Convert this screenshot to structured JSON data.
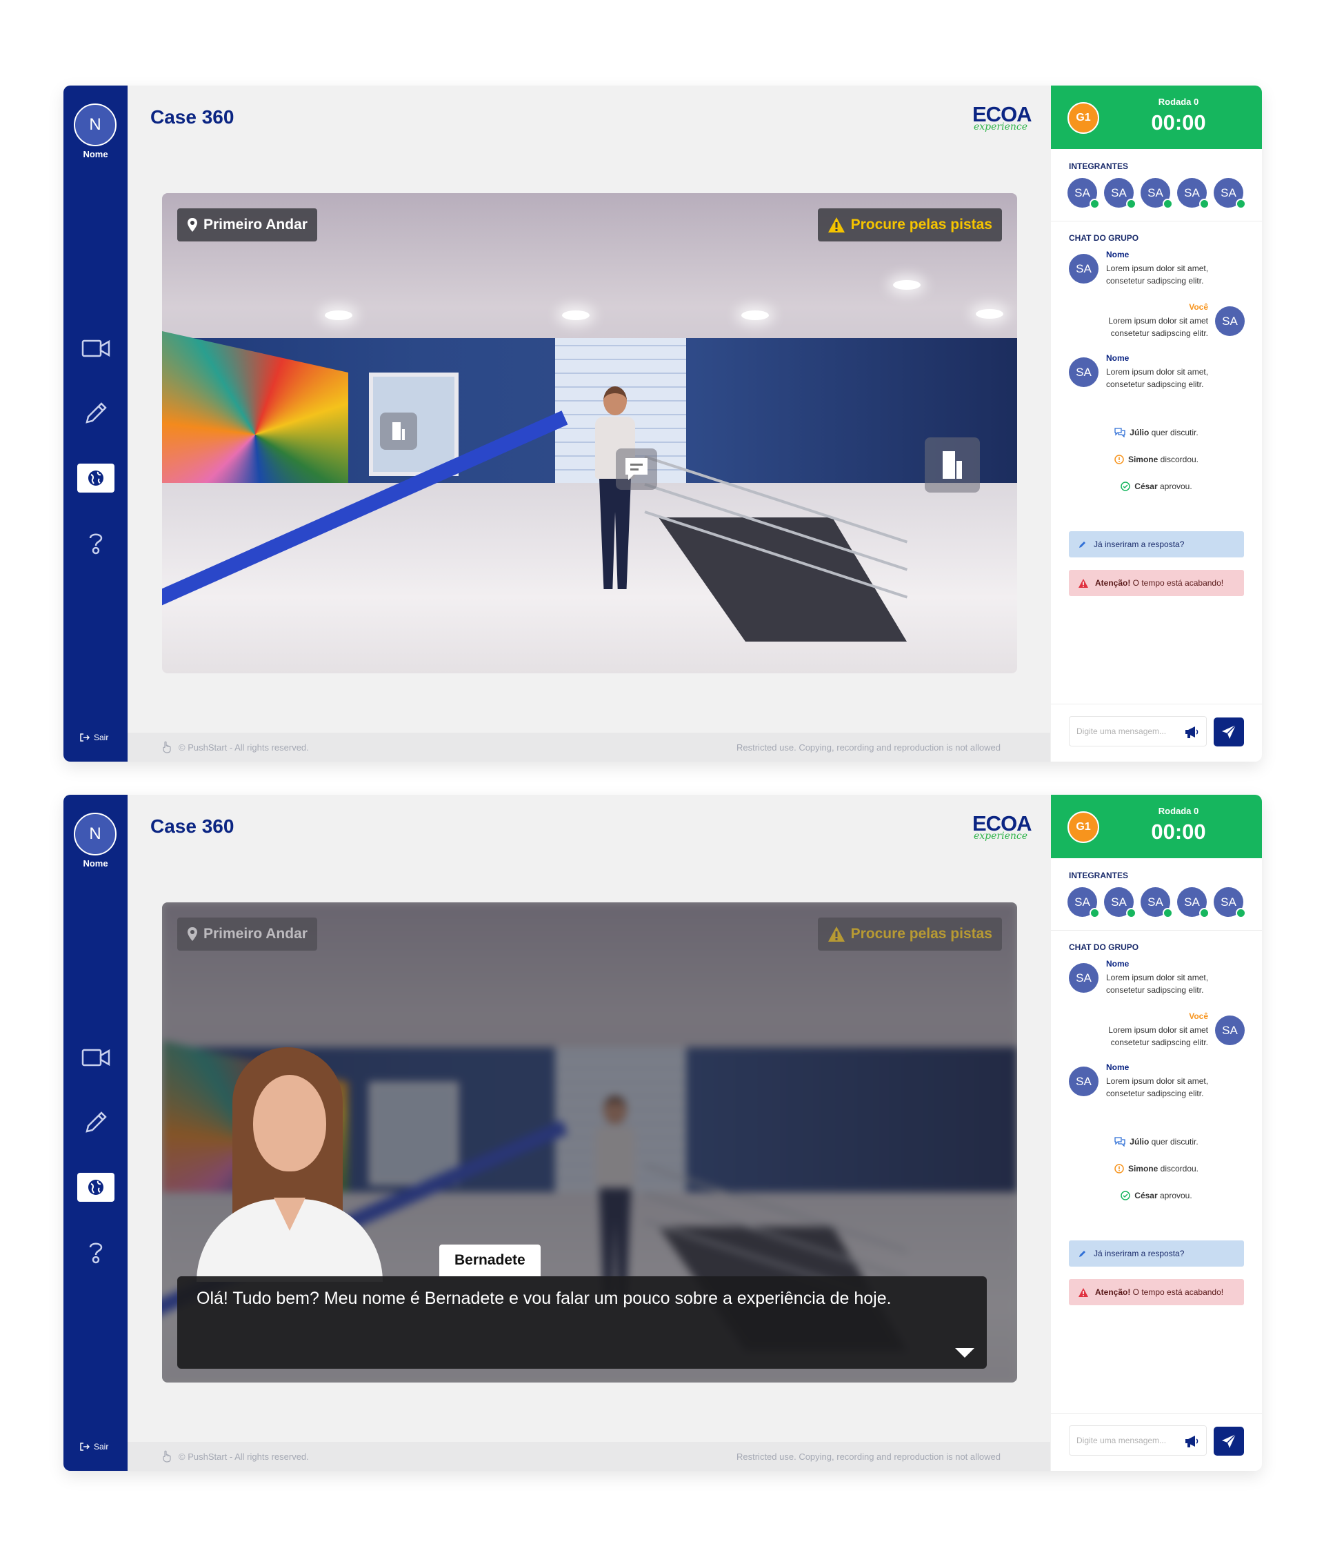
{
  "user": {
    "initial": "N",
    "name": "Nome"
  },
  "sidebar": {
    "logout_label": "Sair"
  },
  "page": {
    "title": "Case 360"
  },
  "logo": {
    "main": "ECOA",
    "sub": "experience"
  },
  "viewer": {
    "location_label": "Primeiro Andar",
    "hint_label": "Procure pelas pistas"
  },
  "dialog": {
    "speaker": "Bernadete",
    "text": "Olá! Tudo bem? Meu nome é Bernadete e vou falar um pouco sobre a experiência de hoje."
  },
  "footer": {
    "copyright": "© PushStart - All rights reserved.",
    "restriction": "Restricted use. Copying, recording and reproduction is not allowed"
  },
  "panel": {
    "group_badge": "G1",
    "round_label": "Rodada 0",
    "timer": "00:00",
    "members_label": "INTEGRANTES",
    "members": [
      "SA",
      "SA",
      "SA",
      "SA",
      "SA"
    ],
    "chat_label": "CHAT  DO GRUPO",
    "messages": [
      {
        "initials": "SA",
        "author": "Nome",
        "text": "Lorem ipsum dolor sit amet, consetetur sadipscing elitr."
      },
      {
        "initials": "SA",
        "author": "Você",
        "text": "Lorem ipsum dolor sit amet consetetur sadipscing elitr."
      },
      {
        "initials": "SA",
        "author": "Nome",
        "text": "Lorem ipsum dolor sit amet, consetetur sadipscing elitr."
      }
    ],
    "events": [
      {
        "name": "Júlio",
        "action": " quer discutir."
      },
      {
        "name": "Simone",
        "action": " discordou."
      },
      {
        "name": "César",
        "action": " aprovou."
      }
    ],
    "alert_info": "Já inseriram a resposta?",
    "alert_warn_strong": "Atenção!",
    "alert_warn_text": " O tempo está acabando!",
    "input_placeholder": "Digite uma mensagem..."
  },
  "colors": {
    "primary": "#0b2583",
    "accent_green": "#16b65e",
    "accent_orange": "#f7941d",
    "hint_yellow": "#f5c400"
  },
  "icons": [
    "video-camera-icon",
    "pencil-icon",
    "globe-icon",
    "help-icon",
    "logout-icon",
    "map-pin-icon",
    "warning-icon",
    "chat-bubble-icon",
    "door-icon",
    "megaphone-icon",
    "send-icon",
    "pencil-small-icon",
    "chat-icon",
    "alert-circle-icon",
    "check-circle-icon",
    "triangle-warning-icon",
    "hand-icon"
  ]
}
